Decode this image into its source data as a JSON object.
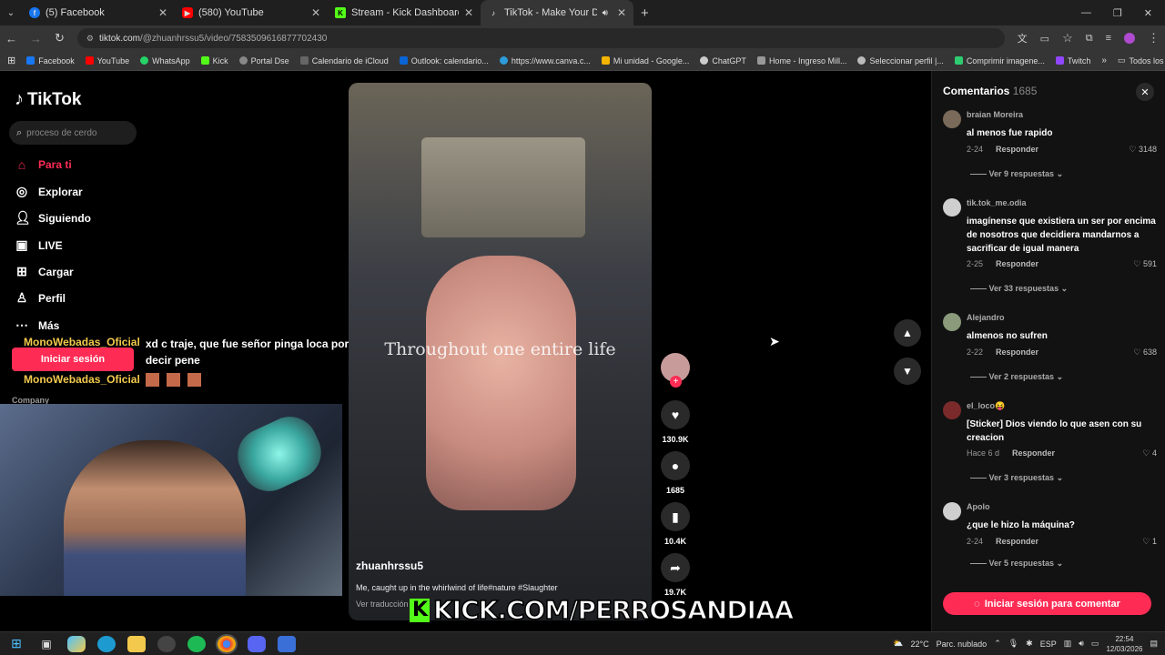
{
  "browser": {
    "tabs": [
      {
        "title": "(5) Facebook",
        "icon": "facebook-icon",
        "color": "#1877f2"
      },
      {
        "title": "(580) YouTube",
        "icon": "youtube-icon",
        "color": "#ff0000"
      },
      {
        "title": "Stream - Kick Dashboard",
        "icon": "kick-icon",
        "color": "#53fc18"
      },
      {
        "title": "TikTok - Make Your Day",
        "icon": "tiktok-icon",
        "color": "#ffffff"
      }
    ],
    "url_host": "tiktok.com",
    "url_path": "/@zhuanhrssu5/video/7583509616877702430",
    "bookmarks": [
      "Facebook",
      "YouTube",
      "WhatsApp",
      "Kick",
      "Portal Dse",
      "Calendario de iCloud",
      "Outlook: calendario...",
      "https://www.canva.c...",
      "Mi unidad - Google...",
      "ChatGPT",
      "Home - Ingreso Mill...",
      "Seleccionar perfil |...",
      "Comprimir imagene...",
      "Twitch"
    ],
    "bookmarks_folder": "Todos los marcadores"
  },
  "tiktok": {
    "logo": "TikTok",
    "search_placeholder": "proceso de cerdo",
    "nav": [
      {
        "label": "Para ti",
        "icon": "home-icon",
        "active": true
      },
      {
        "label": "Explorar",
        "icon": "compass-icon"
      },
      {
        "label": "Siguiendo",
        "icon": "following-icon"
      },
      {
        "label": "LIVE",
        "icon": "live-icon"
      },
      {
        "label": "Cargar",
        "icon": "upload-icon"
      },
      {
        "label": "Perfil",
        "icon": "profile-icon"
      },
      {
        "label": "Más",
        "icon": "more-icon"
      }
    ],
    "login_button": "Iniciar sesión",
    "company": "Company",
    "video": {
      "overlay_text": "Throughout one entire life",
      "username": "zhuanhrssu5",
      "description": "Me, caught up in the whirlwind of life#nature #Slaughter",
      "translate": "Ver traducción"
    },
    "actions": {
      "likes": "130.9K",
      "comments": "1685",
      "saves": "10.4K",
      "shares": "19.7K"
    },
    "comments_title": "Comentarios",
    "comments_count": "1685",
    "comments": [
      {
        "user": "braian Moreira",
        "text": "al menos fue rapido",
        "date": "2-24",
        "reply": "Responder",
        "likes": "3148",
        "more": "Ver 9 respuestas"
      },
      {
        "user": "tik.tok_me.odia",
        "text": "imagínense que existiera un ser por encima de nosotros que decidiera mandarnos a sacrificar de igual manera",
        "date": "2-25",
        "reply": "Responder",
        "likes": "591",
        "more": "Ver 33 respuestas"
      },
      {
        "user": "Alejandro",
        "text": "almenos no sufren",
        "date": "2-22",
        "reply": "Responder",
        "likes": "638",
        "more": "Ver 2 respuestas"
      },
      {
        "user": "el_loco😝",
        "text": "[Sticker] Dios viendo lo que asen con su creacion",
        "date": "Hace 6 d",
        "reply": "Responder",
        "likes": "4",
        "more": "Ver 3 respuestas"
      },
      {
        "user": "Apolo",
        "text": "¿que le hizo la máquina?",
        "date": "2-24",
        "reply": "Responder",
        "likes": "1",
        "more": "Ver 5 respuestas"
      }
    ],
    "comment_login": "Iniciar sesión para comentar"
  },
  "stream_overlay": {
    "chat": [
      {
        "user": "MonoWebadas_Oficial",
        "message": "xd c traje, que fue señor pinga loca por no decir pene"
      },
      {
        "user": "MonoWebadas_Oficial",
        "message": ""
      }
    ],
    "kick_banner": "KICK.COM/PERROSANDIAA"
  },
  "taskbar": {
    "weather": "22°C",
    "weather_desc": "Parc. nublado",
    "lang": "ESP",
    "time": "22:54",
    "date": "12/03/2026"
  }
}
